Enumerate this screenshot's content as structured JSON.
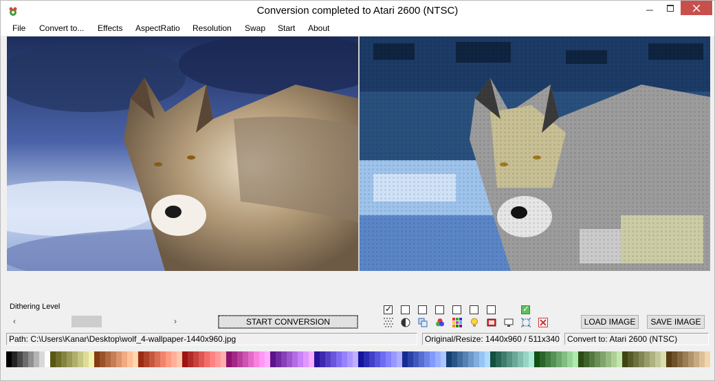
{
  "window": {
    "title": "Conversion completed to Atari 2600 (NTSC)"
  },
  "menu": [
    "File",
    "Convert to...",
    "Effects",
    "AspectRatio",
    "Resolution",
    "Swap",
    "Start",
    "About"
  ],
  "images": {
    "left": "original-wolf-photo",
    "right": "converted-wolf-atari2600"
  },
  "dithering": {
    "label": "Dithering Level",
    "level_fraction": 0.41
  },
  "buttons": {
    "start": "START CONVERSION",
    "load": "LOAD IMAGE",
    "save": "SAVE IMAGE"
  },
  "options": [
    {
      "icon": "dither-pattern-icon",
      "checked": true
    },
    {
      "icon": "contrast-icon",
      "checked": false
    },
    {
      "icon": "copy-layers-icon",
      "checked": false
    },
    {
      "icon": "rgb-circles-icon",
      "checked": false
    },
    {
      "icon": "color-grid-icon",
      "checked": false
    },
    {
      "icon": "lightbulb-icon",
      "checked": false
    },
    {
      "icon": "film-icon",
      "checked": false
    },
    {
      "icon": "monitor-icon",
      "checked": false
    },
    {
      "icon": "crop-frame-icon",
      "checked": false
    },
    {
      "icon": "red-x-icon",
      "checked": true
    }
  ],
  "status": {
    "path_label": "Path:",
    "path": "C:\\Users\\Kanar\\Desktop\\wolf_4-wallpaper-1440x960.jpg",
    "resize_label": "Original/Resize:",
    "resize": "1440x960 / 511x340",
    "convert_label": "Convert to:",
    "convert": "Atari 2600 (NTSC)"
  },
  "colors": {
    "close_button": "#c7504d",
    "check_green": "#5fbf5f"
  }
}
